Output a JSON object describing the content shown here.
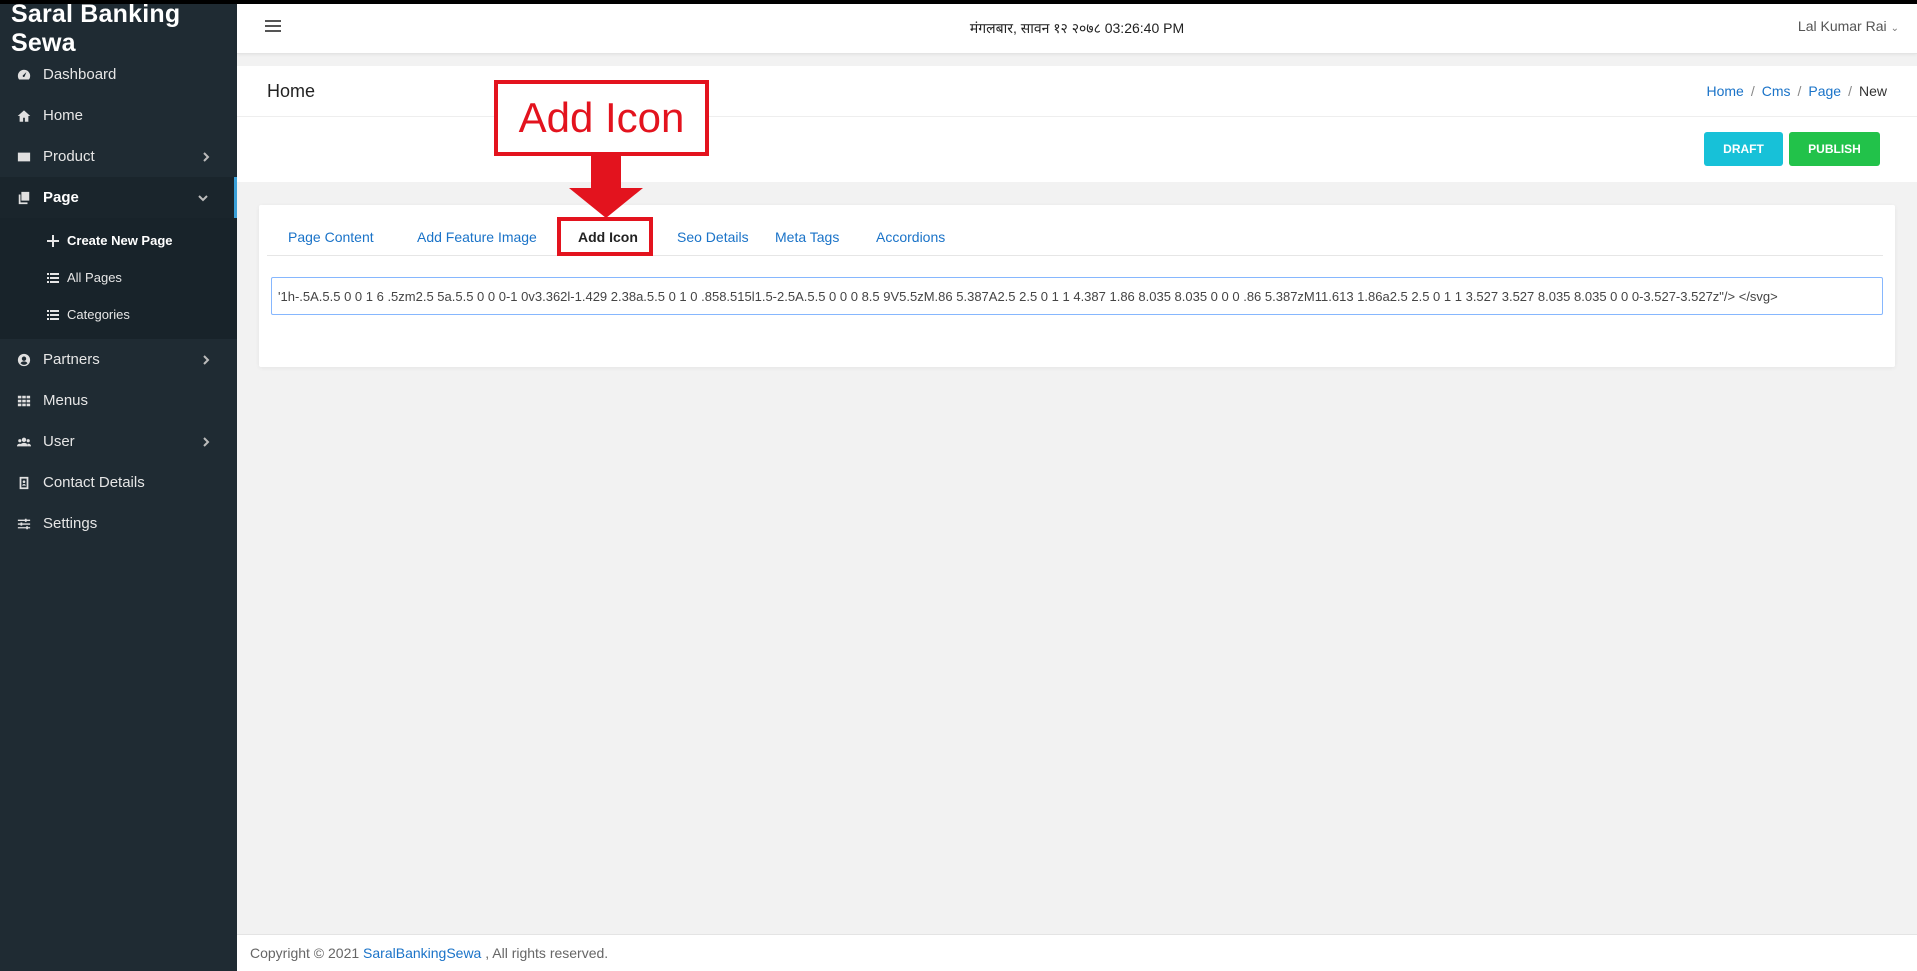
{
  "app": {
    "brand": "Saral Banking Sewa"
  },
  "header": {
    "datetime": "मंगलबार, सावन १२ २०७८ 03:26:40 PM",
    "user": "Lal Kumar Rai"
  },
  "sidebar": {
    "items": [
      {
        "label": "Dashboard",
        "icon": "dashboard-icon"
      },
      {
        "label": "Home",
        "icon": "home-icon"
      },
      {
        "label": "Product",
        "icon": "credit-card-icon"
      },
      {
        "label": "Page",
        "icon": "copy-icon"
      },
      {
        "label": "Partners",
        "icon": "user-circle-icon"
      },
      {
        "label": "Menus",
        "icon": "grid-icon"
      },
      {
        "label": "User",
        "icon": "users-icon"
      },
      {
        "label": "Contact Details",
        "icon": "address-book-icon"
      },
      {
        "label": "Settings",
        "icon": "sliders-icon"
      }
    ],
    "page_sub": [
      {
        "label": "Create New Page",
        "icon": "plus-icon"
      },
      {
        "label": "All Pages",
        "icon": "list-icon"
      },
      {
        "label": "Categories",
        "icon": "list-icon"
      }
    ]
  },
  "page": {
    "title": "Home",
    "breadcrumb": [
      "Home",
      "Cms",
      "Page",
      "New"
    ],
    "draft_label": "DRAFT",
    "publish_label": "PUBLISH"
  },
  "tabs": [
    "Page Content",
    "Add Feature Image",
    "Add Icon",
    "Seo Details",
    "Meta Tags",
    "Accordions"
  ],
  "icon_input": {
    "value": "'1h-.5A.5.5 0 0 1 6 .5zm2.5 5a.5.5 0 0 0-1 0v3.362l-1.429 2.38a.5.5 0 1 0 .858.515l1.5-2.5A.5.5 0 0 0 8.5 9V5.5zM.86 5.387A2.5 2.5 0 1 1 4.387 1.86 8.035 8.035 0 0 0 .86 5.387zM11.613 1.86a2.5 2.5 0 1 1 3.527 3.527 8.035 8.035 0 0 0-3.527-3.527z\"/> </svg>"
  },
  "annotation": {
    "label": "Add Icon",
    "color": "#e3131e"
  },
  "footer": {
    "prefix": "Copyright © 2021",
    "link": "SaralBankingSewa",
    "suffix": ", All rights reserved."
  },
  "colors": {
    "sidebar": "#1f2b33",
    "link": "#1a73c8",
    "draft": "#17c1d8",
    "publish": "#22c24a"
  }
}
